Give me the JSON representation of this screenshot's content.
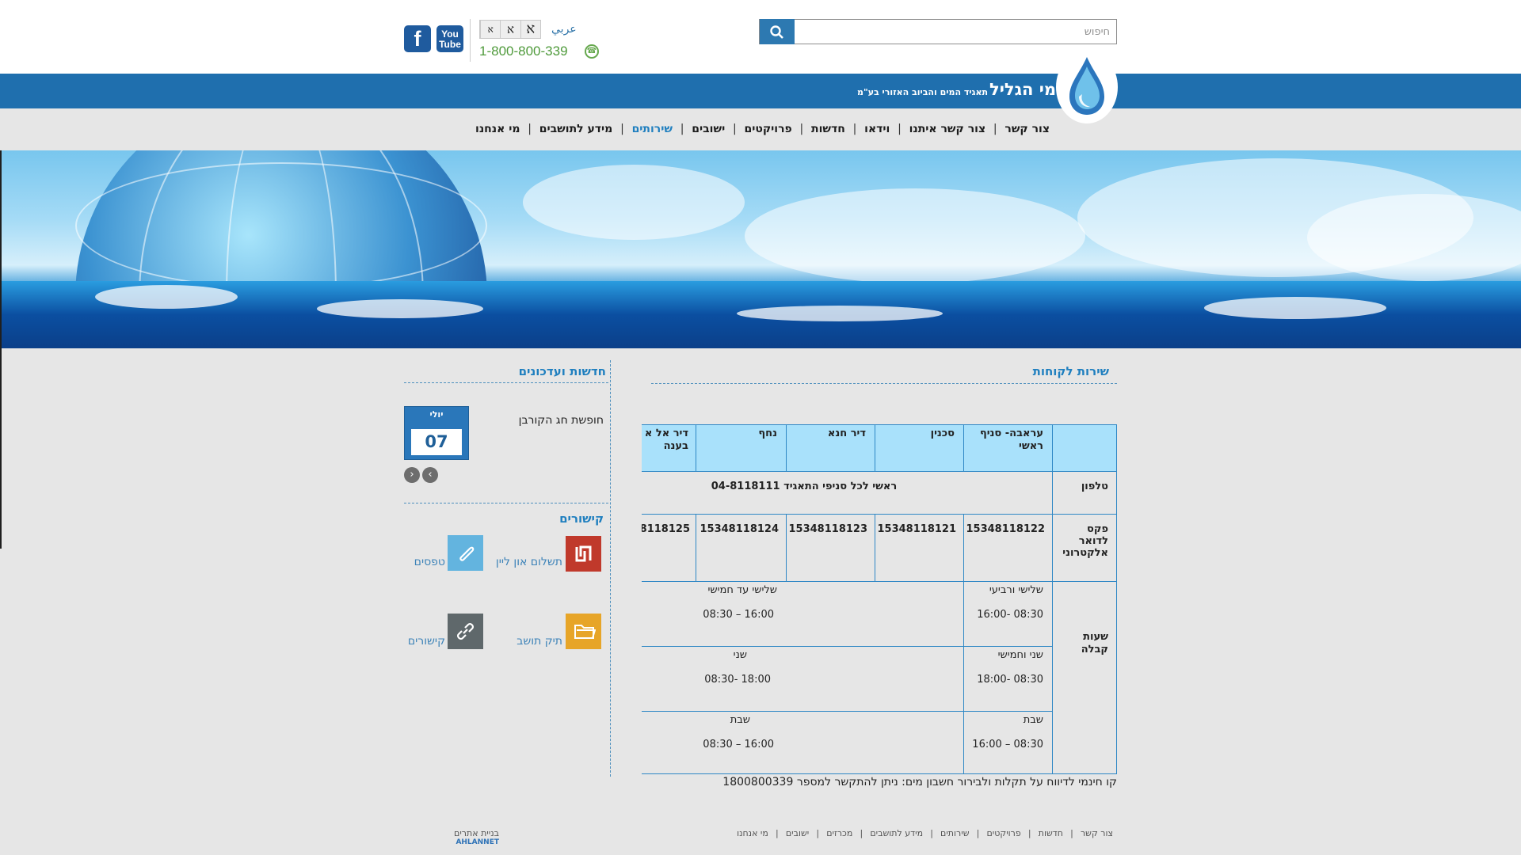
{
  "header": {
    "search_placeholder": "חיפוש",
    "font_sizes": [
      "א",
      "א",
      "א"
    ],
    "arabic_label": "عربي",
    "phone": "1-800-800-339",
    "social": {
      "facebook": "f",
      "youtube": "You Tube"
    }
  },
  "brand": {
    "name": "מי הגליל",
    "tagline": "תאגיד המים והביוב האזורי בע\"מ"
  },
  "nav": [
    "מי אנחנו",
    "מידע לתושבים",
    "שירותים",
    "ישובים",
    "פרויקטים",
    "חדשות",
    "וידאו",
    "צור קשר איתנו",
    "צור קשר"
  ],
  "nav_active_index": 2,
  "news": {
    "title": "חדשות ועדכונים",
    "month": "יולי",
    "day": "07",
    "item": "חופשת חג הקורבן",
    "prev_icon": "chevron-left-icon",
    "next_icon": "chevron-right-icon"
  },
  "links": {
    "title": "קישורים",
    "items": [
      {
        "label": "תשלום און ליין",
        "icon": "shekel-icon",
        "color": "#c0392b"
      },
      {
        "label": "טפסים",
        "icon": "paperclip-icon",
        "color": "#63b4df"
      },
      {
        "label": "תיק תושב",
        "icon": "folder-icon",
        "color": "#e7a528"
      },
      {
        "label": "קישורים",
        "icon": "link-icon",
        "color": "#5f686b"
      }
    ]
  },
  "main": {
    "title": "שירות לקוחות",
    "table_headers": [
      "",
      "עראבה- סניף ראשי",
      "סכנין",
      "דיר חנא",
      "נחף",
      "דיר אל א בענה"
    ],
    "phone_label": "טלפון",
    "phone_value": "ראשי לכל סניפי התאגיד 04-8118111",
    "fax_label": "פקס לדואר אלקטרוני",
    "fax_values": [
      "15348118122",
      "15348118121",
      "15348118123",
      "15348118124",
      "8118125"
    ],
    "hours_label": "שעות קבלה",
    "hours_rows": [
      {
        "left_title": "שלישי ורביעי",
        "left_hours": "08:30 -16:00",
        "right_title": "שלישי עד חמישי",
        "right_hours": "16:00 – 08:30"
      },
      {
        "left_title": "שני וחמישי",
        "left_hours": "08:30 -18:00",
        "right_title": "שני",
        "right_hours": "18:00 -08:30"
      },
      {
        "left_title": "שבת",
        "left_hours": "08:30 – 16:00",
        "right_title": "שבת",
        "right_hours": "16:00 – 08:30"
      }
    ],
    "note": "קו חינמי לדיווח על תקלות ולבירור חשבון מים: ניתן להתקשר למספר 1800800339"
  },
  "footer": {
    "nav": [
      "מי אנחנו",
      "ישובים",
      "מכרזים",
      "מידע לתושבים",
      "שירותים",
      "פרויקטים",
      "חדשות",
      "צור קשר"
    ],
    "credit_line1": "בניית אתרים",
    "credit_line2": "AHLANNET"
  },
  "colors": {
    "brand_blue": "#1f6fae",
    "accent_blue": "#1f7fbf",
    "table_header": "#a9e1fb"
  }
}
